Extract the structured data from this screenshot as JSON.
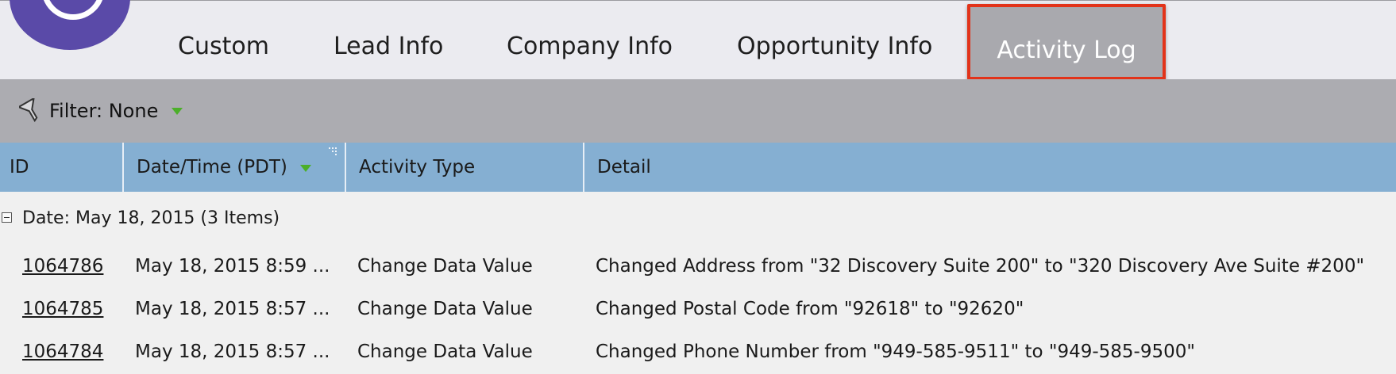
{
  "tabs": [
    {
      "label": "Custom"
    },
    {
      "label": "Lead Info"
    },
    {
      "label": "Company Info"
    },
    {
      "label": "Opportunity Info"
    },
    {
      "label": "Activity Log",
      "active": true
    }
  ],
  "filter": {
    "label": "Filter: None",
    "icon": "funnel-icon"
  },
  "table": {
    "columns": [
      "ID",
      "Date/Time (PDT)",
      "Activity Type",
      "Detail"
    ],
    "sort_column": "Date/Time (PDT)",
    "group": {
      "label": "Date: May 18, 2015 (3 Items)",
      "collapsed": false
    },
    "rows": [
      {
        "id": "1064786",
        "datetime": "May 18, 2015 8:59 ...",
        "type": "Change Data Value",
        "detail": "Changed Address from \"32 Discovery Suite 200\" to \"320 Discovery Ave Suite #200\""
      },
      {
        "id": "1064785",
        "datetime": "May 18, 2015 8:57 ...",
        "type": "Change Data Value",
        "detail": "Changed Postal Code from \"92618\" to \"92620\""
      },
      {
        "id": "1064784",
        "datetime": "May 18, 2015 8:57 ...",
        "type": "Change Data Value",
        "detail": "Changed Phone Number from \"949-585-9511\" to \"949-585-9500\""
      }
    ]
  },
  "colors": {
    "logo": "#5a4aa8",
    "tab_active_bg": "#a9a9ae",
    "tab_active_border": "#e2331a",
    "filter_bar": "#acacb1",
    "header_bg": "#85afd2",
    "sort_arrow": "#4caf2a"
  }
}
